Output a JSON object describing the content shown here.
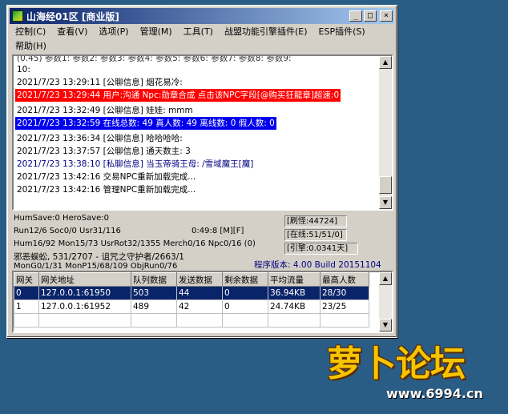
{
  "window": {
    "title": "山海经01区 [商业版]",
    "buttons": {
      "minimize": "_",
      "maximize": "□",
      "close": "×"
    }
  },
  "menu": [
    "控制(C)",
    "查看(V)",
    "选项(P)",
    "管理(M)",
    "工具(T)",
    "战盟功能引擎插件(E)",
    "ESP插件(S)",
    "帮助(H)"
  ],
  "log": {
    "partial_top": "(0.45) 参数1: 参数2: 参数3: 参数4: 参数5: 参数6: 参数7: 参数8: 参数9:",
    "lines": [
      {
        "text": "10:",
        "style": "normal"
      },
      {
        "text": "2021/7/23 13:29:11 [公聊信息] 烟花易冷:",
        "style": "normal"
      },
      {
        "text": "2021/7/23 13:29:44 用户:沟通 Npc:勋章合成 点击该NPC字段[@购买狂龍章]超速:0",
        "style": "red"
      },
      {
        "text": "2021/7/23 13:32:49 [公聊信息] 娃娃: mmm",
        "style": "normal"
      },
      {
        "text": "2021/7/23 13:32:59 在线总数: 49 真人数: 49 离线数: 0 假人数: 0",
        "style": "blue-bg"
      },
      {
        "text": "2021/7/23 13:36:34 [公聊信息] 哈哈哈哈:",
        "style": "normal"
      },
      {
        "text": "2021/7/23 13:37:57 [公聊信息] 通天数主: 3",
        "style": "normal"
      },
      {
        "text": "2021/7/23 13:38:10 [私聊信息] 当玉帝骑王母: /雪域魔王[魔]",
        "style": "blue-text"
      },
      {
        "text": "2021/7/23 13:42:16 交易NPC重新加载完成...",
        "style": "normal"
      },
      {
        "text": "2021/7/23 13:42:16 管理NPC重新加载完成...",
        "style": "normal"
      }
    ]
  },
  "status": {
    "hum_save": "HumSave:0 HeroSave:0",
    "run": "Run12/6 Soc0/0 Usr31/116",
    "time": "0:49:8 [M][F]",
    "hum": "Hum16/92 Mon15/73 UsrRot32/1355 Merch0/16 Npc0/16 (0)",
    "monster": "邪恶蜈蚣, 531/2707 - 诅咒之守护者/2663/1",
    "mon": "MonG0/1/31 MonP15/68/109 ObjRun0/76",
    "refresh": "[刷怪:44724]",
    "online": "[在线:51/51/0]",
    "engine": "[引擎:0.0341天]",
    "version": "程序版本: 4.00 Build 20151104"
  },
  "gateways": {
    "columns": [
      "网关",
      "网关地址",
      "队列数据",
      "发送数据",
      "剩余数据",
      "平均流量",
      "最高人数"
    ],
    "rows": [
      [
        "0",
        "127.0.0.1:61950",
        "503",
        "44",
        "0",
        "36.94KB",
        "28/30"
      ],
      [
        "1",
        "127.0.0.1:61952",
        "489",
        "42",
        "0",
        "24.74KB",
        "23/25"
      ]
    ]
  },
  "watermark": {
    "logo": "萝卜论坛",
    "url": "www.6994.cn"
  }
}
